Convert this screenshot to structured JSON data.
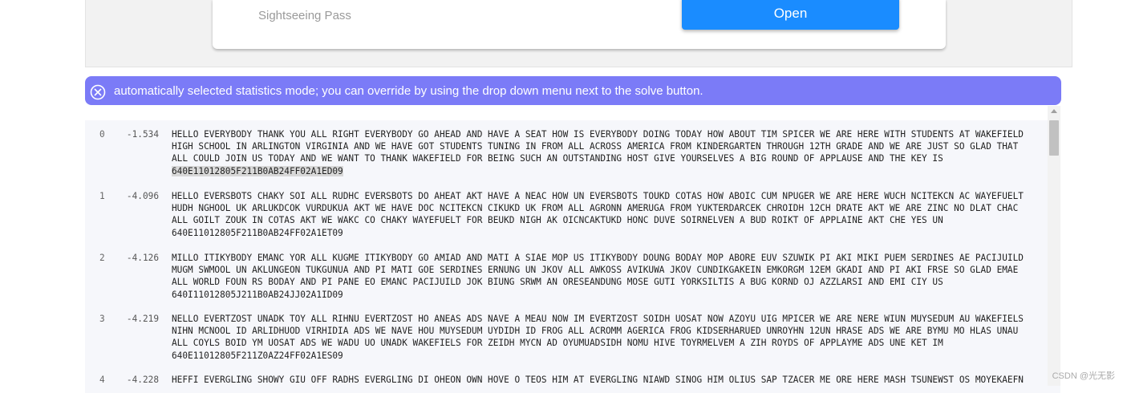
{
  "top_card": {
    "label": "Sightseeing Pass",
    "button_label": "Open"
  },
  "notice": {
    "icon": "circle-x-icon",
    "text": "automatically selected statistics mode; you can override by using the drop down menu next to the solve button.",
    "background": "#7b7bf7"
  },
  "results": [
    {
      "index": "0",
      "score": "-1.534",
      "text": "HELLO EVERYBODY THANK YOU ALL RIGHT EVERYBODY GO AHEAD AND HAVE A SEAT HOW IS EVERYBODY DOING TODAY HOW ABOUT TIM SPICER WE ARE HERE WITH STUDENTS AT WAKEFIELD\nHIGH SCHOOL IN ARLINGTON VIRGINIA AND WE HAVE GOT STUDENTS TUNING IN FROM ALL ACROSS AMERICA FROM KINDERGARTEN THROUGH 12TH GRADE AND WE ARE JUST SO GLAD THAT\nALL COULD JOIN US TODAY AND WE WANT TO THANK WAKEFIELD FOR BEING SUCH AN OUTSTANDING HOST GIVE YOURSELVES A BIG ROUND OF APPLAUSE AND THE KEY IS",
      "key": "640E11012805F211B0AB24FF02A1ED09",
      "highlight": true
    },
    {
      "index": "1",
      "score": "-4.096",
      "text": "HELLO EVERSBOTS CHAKY SOI ALL RUDHC EVERSBOTS DO AHEAT AKT HAVE A NEAC HOW UN EVERSBOTS TOUKD COTAS HOW ABOIC CUM NPUGER WE ARE HERE WUCH NCITEKCN AC WAYEFUELT\nHUDH NGHOOL UK ARLUKDCOK VURDUKUA AKT WE HAVE DOC NCITEKCN CIKUKD UK FROM ALL AGRONN AMERUGA FROM YUKTERDARCEK CHROIDH 12CH DRATE AKT WE ARE ZINC NO DLAT CHAC\nALL GOILT ZOUK IN COTAS AKT WE WAKC CO CHAKY WAYEFUELT FOR BEUKD NIGH AK OICNCAKTUKD HONC DUVE SOIRNELVEN A BUD ROIKT OF APPLAINE AKT CHE YES UN",
      "key": "640E11012805F211B0AB24FF02A1ET09",
      "highlight": false
    },
    {
      "index": "2",
      "score": "-4.126",
      "text": "MILLO ITIKYBODY EMANC YOR ALL KUGME ITIKYBODY GO AMIAD AND MATI A SIAE MOP US ITIKYBODY DOUNG BODAY MOP ABORE EUV SZUWIK PI AKI MIKI PUEM SERDINES AE PACIJUILD\nMUGM SWMOOL UN AKLUNGEON TUKGUNUA AND PI MATI GOE SERDINES ERNUNG UN JKOV ALL AWKOSS AVIKUWA JKOV CUNDIKGAKEIN EMKORGM 12EM GKADI AND PI AKI FRSE SO GLAD EMAE\nALL WORLD FOUN RS BODAY AND PI PANE EO EMANC PACIJUILD JOK BIUNG SRWM AN ORESEANDUNG MOSE GUTI YORKSILTIS A BUG KORND OJ AZZLARSI AND EMI CIY US",
      "key": "640I11012805J211B0AB24JJ02A1ID09",
      "highlight": false
    },
    {
      "index": "3",
      "score": "-4.219",
      "text": "NELLO EVERTZOST UNADK TOY ALL RIHNU EVERTZOST HO ANEAS ADS NAVE A MEAU NOW IM EVERTZOST SOIDH UOSAT NOW AZOYU UIG MPICER WE ARE NERE WIUN MUYSEDUM AU WAKEFIELS\nNIHN MCNOOL ID ARLIDHUOD VIRHIDIA ADS WE NAVE HOU MUYSEDUM UYDIDH ID FROG ALL ACROMM AGERICA FROG KIDSERHARUED UNROYHN 12UN HRASE ADS WE ARE BYMU MO HLAS UNAU\nALL COYLS BOID YM UOSAT ADS WE WADU UO UNADK WAKEFIELS FOR ZEIDH MYCN AD OYUMUADSIDH NOMU HIVE TOYRMELVEM A ZIH ROYDS OF APPLAYME ADS UNE KET IM",
      "key": "640E11012805F211Z0AZ24FF02A1ES09",
      "highlight": false
    },
    {
      "index": "4",
      "score": "-4.228",
      "text": "HEFFI EVERGLING SHOWY GIU OFF RADHS EVERGLING DI OHEON OWN HOVE O TEOS HIM AT EVERGLING NIAWD SINOG HIM OLIUS SAP TZACER ME ORE HERE MASH TSUNEWST OS MOYEKAEFN",
      "key": "",
      "highlight": false
    }
  ],
  "watermark": "CSDN @光无影"
}
